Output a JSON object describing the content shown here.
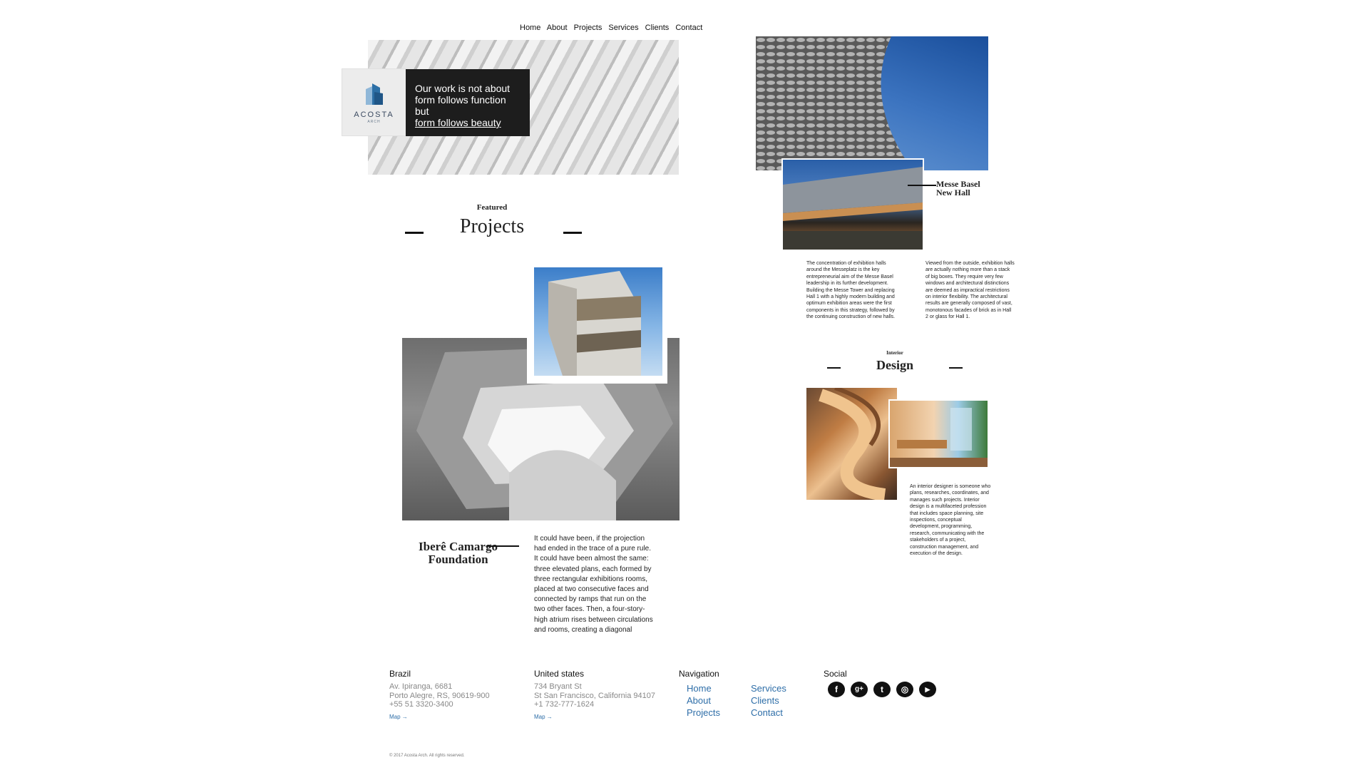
{
  "nav": {
    "items": [
      "Home",
      "About",
      "Projects",
      "Services",
      "Clients",
      "Contact"
    ]
  },
  "hero": {
    "logo_name": "ACOSTA",
    "logo_sub": "ARCH",
    "tagline_line1": "Our work is not about",
    "tagline_line2": "form follows function but",
    "tagline_link": "form follows beauty"
  },
  "featured": {
    "small": "Featured",
    "big": "Projects"
  },
  "project": {
    "title_line1": "Iberê Camargo",
    "title_line2": "Foundation",
    "text": "It could have been, if the projection had ended in the trace of a pure rule. It could have been almost the same: three elevated plans, each formed by three rectangular exhibitions rooms, placed at two consecutive faces and connected by ramps that run on the two other faces. Then, a four-story-high atrium rises between circulations and rooms, creating a diagonal"
  },
  "basel": {
    "title_line1": "Messe Basel",
    "title_line2": "New Hall",
    "text_left": "The concentration of exhibition halls around the Messeplatz is the key entrepreneurial aim of the Messe Basel leadership in its further development. Building the Messe Tower and replacing Hall 1 with a highly modern building and optimum exhibition areas were the first components in this strategy, followed by the continuing construction of new halls.",
    "text_right": "Viewed from the outside, exhibition halls are actually nothing more than a stack of big boxes. They require very few windows and architectural distinctions are deemed as impractical restrictions on interior flexibility. The architectural results are generally composed of vast, monotonous facades of brick as in Hall 2 or glass for Hall 1."
  },
  "interior": {
    "small": "Interior",
    "big": "Design",
    "text": "An interior designer is someone who plans, researches, coordinates, and manages such projects. Interior design is a multifaceted profession that includes space planning, site inspections, conceptual development, programming, research, communicating with the stakeholders of a project, construction management, and execution of the design."
  },
  "footer": {
    "brazil": {
      "heading": "Brazil",
      "line1": "Av. Ipiranga, 6681",
      "line2": "Porto Alegre, RS, 90619-900",
      "line3": "+55 51 3320-3400",
      "map": "Map →"
    },
    "us": {
      "heading": "United states",
      "line1": "734 Bryant St",
      "line2": "St San Francisco, California 94107",
      "line3": "+1 732-777-1624",
      "map": "Map →"
    },
    "navigation": {
      "heading": "Navigation",
      "col1": [
        "Home",
        "About",
        "Projects"
      ],
      "col2": [
        "Services",
        "Clients",
        "Contact"
      ]
    },
    "social": {
      "heading": "Social",
      "icons": [
        {
          "name": "facebook-icon",
          "glyph": "f"
        },
        {
          "name": "google-plus-icon",
          "glyph": "g+"
        },
        {
          "name": "twitter-icon",
          "glyph": "t"
        },
        {
          "name": "instagram-icon",
          "glyph": "◎"
        },
        {
          "name": "youtube-icon",
          "glyph": "▶"
        }
      ]
    },
    "copyright": "© 2017 Acosta Arch. All rights reserved."
  },
  "colors": {
    "accent_link": "#2e6ea8",
    "dark_box": "#1d1d1d"
  }
}
